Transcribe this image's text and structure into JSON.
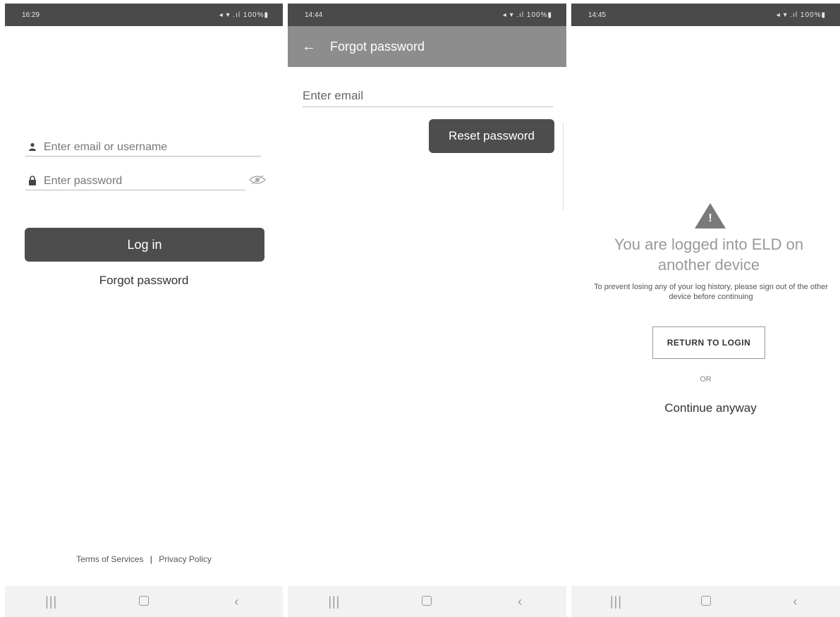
{
  "login": {
    "status_time": "16:29",
    "status_right": "◂ ▾ .ıl 100%▮",
    "email_placeholder": "Enter email or username",
    "password_placeholder": "Enter password",
    "login_button": "Log in",
    "forgot_link": "Forgot password",
    "terms_link": "Terms of Services",
    "separator": "|",
    "privacy_link": "Privacy Policy"
  },
  "forgot": {
    "status_time": "14:44",
    "status_right": "◂ ▾ .ıl 100%▮",
    "back_icon": "←",
    "title": "Forgot password",
    "email_placeholder": "Enter email",
    "reset_button": "Reset password"
  },
  "eld": {
    "status_time": "14:45",
    "status_right": "◂ ▾ .ıl 100%▮",
    "heading": "You are logged into ELD on another device",
    "message": "To prevent losing any of your log history, please sign out of the other device before continuing",
    "return_button": "RETURN TO LOGIN",
    "or_text": "OR",
    "continue_link": "Continue anyway"
  },
  "icons": {
    "user": "user-icon",
    "lock": "lock-icon",
    "eye": "eye-icon",
    "warning": "warning-icon",
    "back": "back-arrow-icon"
  },
  "colors": {
    "status_bar": "#4a4a4a",
    "primary_button": "#4d4d4d",
    "app_bar": "#8d8d8d"
  }
}
